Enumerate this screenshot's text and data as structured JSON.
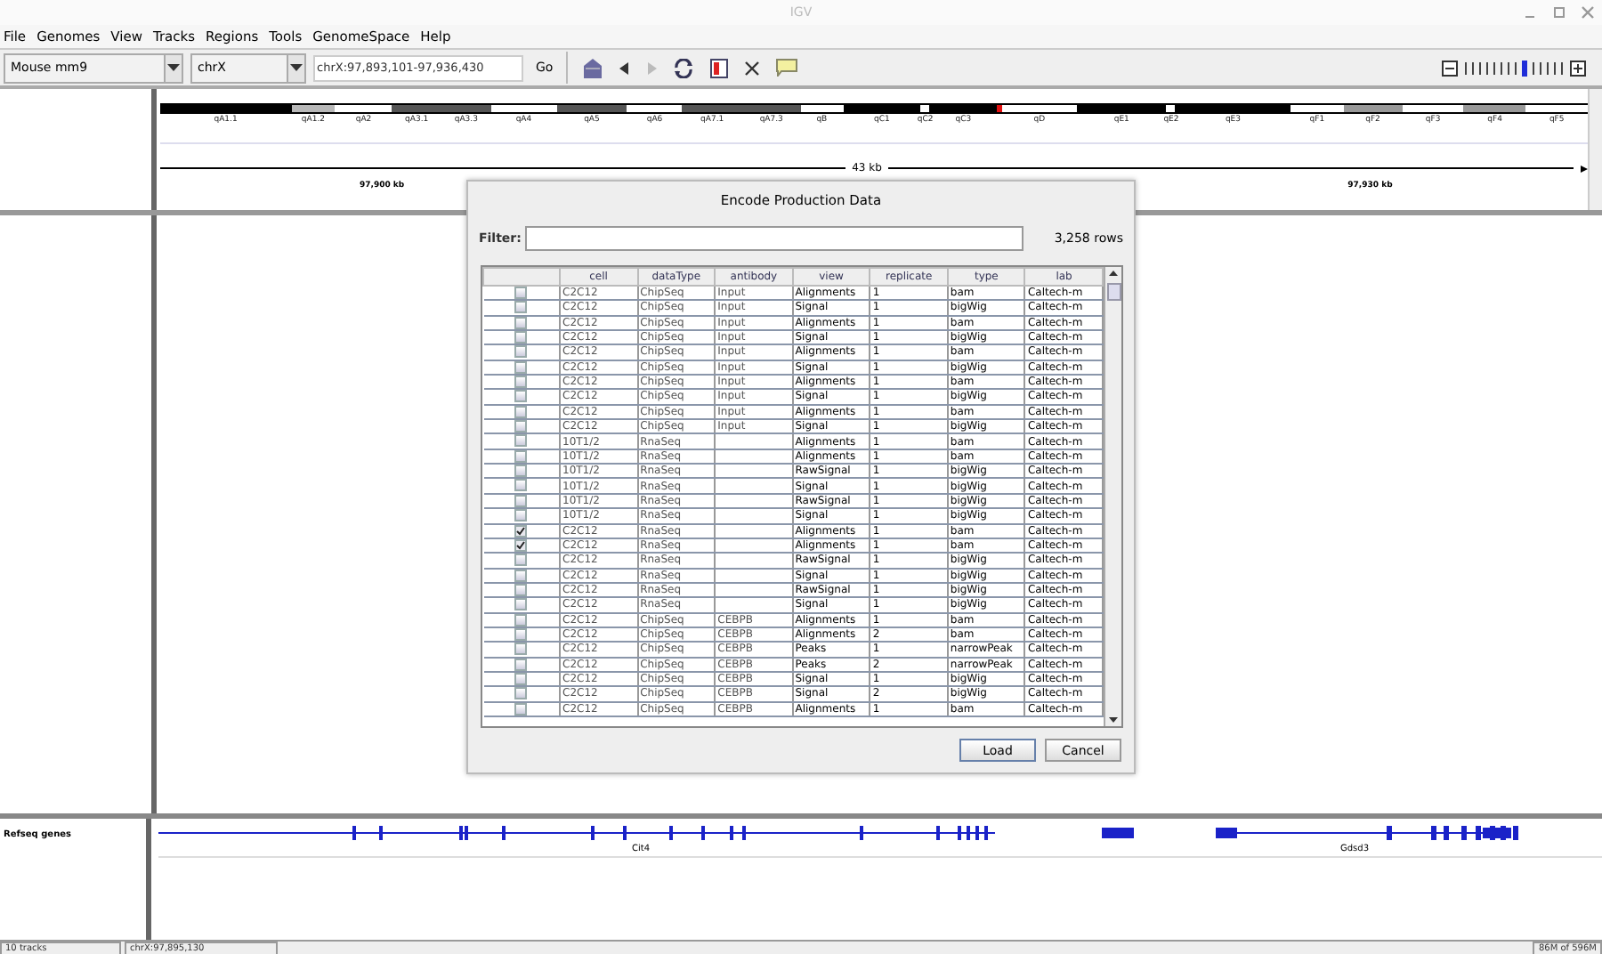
{
  "window": {
    "title": "IGV"
  },
  "menu": [
    "File",
    "Genomes",
    "View",
    "Tracks",
    "Regions",
    "Tools",
    "GenomeSpace",
    "Help"
  ],
  "toolbar": {
    "genome": "Mouse mm9",
    "chromosome": "chrX",
    "locus": "chrX:97,893,101-97,936,430",
    "go": "Go",
    "zoom": {
      "level": 0.6
    }
  },
  "cytoband": [
    {
      "label": "qA1.1",
      "color": "#000000"
    },
    {
      "label": "qA1.2",
      "color": "#b8b8b8"
    },
    {
      "label": "qA2",
      "color": "#ffffff"
    },
    {
      "label": "qA3.1",
      "color": "#555555"
    },
    {
      "label": "qA3.3",
      "color": "#555555"
    },
    {
      "label": "qA4",
      "color": "#ffffff"
    },
    {
      "label": "qA5",
      "color": "#555555"
    },
    {
      "label": "qA6",
      "color": "#ffffff"
    },
    {
      "label": "qA7.1",
      "color": "#555555"
    },
    {
      "label": "qA7.3",
      "color": "#555555"
    },
    {
      "label": "qB",
      "color": "#ffffff"
    },
    {
      "label": "qC1",
      "color": "#000000"
    },
    {
      "label": "qC2",
      "color": "#ffffff"
    },
    {
      "label": "qC3",
      "color": "#000000"
    },
    {
      "color": "#e01010"
    },
    {
      "label": "qD",
      "color": "#ffffff"
    },
    {
      "label": "qE1",
      "color": "#000000"
    },
    {
      "label": "qE2",
      "color": "#ffffff"
    },
    {
      "label": "qE3",
      "color": "#000000"
    },
    {
      "label": "qF1",
      "color": "#ffffff"
    },
    {
      "label": "qF2",
      "color": "#999999"
    },
    {
      "label": "qF3",
      "color": "#ffffff"
    },
    {
      "label": "qF4",
      "color": "#999999"
    },
    {
      "label": "qF5",
      "color": "#ffffff"
    }
  ],
  "ruler": {
    "span": "43 kb",
    "ticks": [
      "97,900 kb",
      "97,930 kb"
    ]
  },
  "feature_track": {
    "name": "Refseq genes",
    "genes": [
      "Cit4",
      "Gdsd3"
    ]
  },
  "status_bar": [
    "10 tracks",
    "chrX:97,895,130",
    "86M of 596M"
  ],
  "dialog": {
    "title": "Encode Production Data",
    "filter_label": "Filter:",
    "count": "3,258 rows",
    "columns": [
      "cell",
      "dataType",
      "antibody",
      "view",
      "replicate",
      "type",
      "lab"
    ],
    "rows": [
      {
        "checked": false,
        "cells": [
          "C2C12",
          "ChipSeq",
          "Input",
          "Alignments",
          "1",
          "bam",
          "Caltech-m"
        ]
      },
      {
        "checked": false,
        "cells": [
          "C2C12",
          "ChipSeq",
          "Input",
          "Signal",
          "1",
          "bigWig",
          "Caltech-m"
        ]
      },
      {
        "checked": false,
        "cells": [
          "C2C12",
          "ChipSeq",
          "Input",
          "Alignments",
          "1",
          "bam",
          "Caltech-m"
        ]
      },
      {
        "checked": false,
        "cells": [
          "C2C12",
          "ChipSeq",
          "Input",
          "Signal",
          "1",
          "bigWig",
          "Caltech-m"
        ]
      },
      {
        "checked": false,
        "cells": [
          "C2C12",
          "ChipSeq",
          "Input",
          "Alignments",
          "1",
          "bam",
          "Caltech-m"
        ]
      },
      {
        "checked": false,
        "cells": [
          "C2C12",
          "ChipSeq",
          "Input",
          "Signal",
          "1",
          "bigWig",
          "Caltech-m"
        ]
      },
      {
        "checked": false,
        "cells": [
          "C2C12",
          "ChipSeq",
          "Input",
          "Alignments",
          "1",
          "bam",
          "Caltech-m"
        ]
      },
      {
        "checked": false,
        "cells": [
          "C2C12",
          "ChipSeq",
          "Input",
          "Signal",
          "1",
          "bigWig",
          "Caltech-m"
        ]
      },
      {
        "checked": false,
        "cells": [
          "C2C12",
          "ChipSeq",
          "Input",
          "Alignments",
          "1",
          "bam",
          "Caltech-m"
        ]
      },
      {
        "checked": false,
        "cells": [
          "C2C12",
          "ChipSeq",
          "Input",
          "Signal",
          "1",
          "bigWig",
          "Caltech-m"
        ]
      },
      {
        "checked": false,
        "cells": [
          "10T1/2",
          "RnaSeq",
          "",
          "Alignments",
          "1",
          "bam",
          "Caltech-m"
        ]
      },
      {
        "checked": false,
        "cells": [
          "10T1/2",
          "RnaSeq",
          "",
          "Alignments",
          "1",
          "bam",
          "Caltech-m"
        ]
      },
      {
        "checked": false,
        "cells": [
          "10T1/2",
          "RnaSeq",
          "",
          "RawSignal",
          "1",
          "bigWig",
          "Caltech-m"
        ]
      },
      {
        "checked": false,
        "cells": [
          "10T1/2",
          "RnaSeq",
          "",
          "Signal",
          "1",
          "bigWig",
          "Caltech-m"
        ]
      },
      {
        "checked": false,
        "cells": [
          "10T1/2",
          "RnaSeq",
          "",
          "RawSignal",
          "1",
          "bigWig",
          "Caltech-m"
        ]
      },
      {
        "checked": false,
        "cells": [
          "10T1/2",
          "RnaSeq",
          "",
          "Signal",
          "1",
          "bigWig",
          "Caltech-m"
        ]
      },
      {
        "checked": true,
        "cells": [
          "C2C12",
          "RnaSeq",
          "",
          "Alignments",
          "1",
          "bam",
          "Caltech-m"
        ]
      },
      {
        "checked": true,
        "cells": [
          "C2C12",
          "RnaSeq",
          "",
          "Alignments",
          "1",
          "bam",
          "Caltech-m"
        ]
      },
      {
        "checked": false,
        "cells": [
          "C2C12",
          "RnaSeq",
          "",
          "RawSignal",
          "1",
          "bigWig",
          "Caltech-m"
        ]
      },
      {
        "checked": false,
        "cells": [
          "C2C12",
          "RnaSeq",
          "",
          "Signal",
          "1",
          "bigWig",
          "Caltech-m"
        ]
      },
      {
        "checked": false,
        "cells": [
          "C2C12",
          "RnaSeq",
          "",
          "RawSignal",
          "1",
          "bigWig",
          "Caltech-m"
        ]
      },
      {
        "checked": false,
        "cells": [
          "C2C12",
          "RnaSeq",
          "",
          "Signal",
          "1",
          "bigWig",
          "Caltech-m"
        ]
      },
      {
        "checked": false,
        "cells": [
          "C2C12",
          "ChipSeq",
          "CEBPB",
          "Alignments",
          "1",
          "bam",
          "Caltech-m"
        ]
      },
      {
        "checked": false,
        "cells": [
          "C2C12",
          "ChipSeq",
          "CEBPB",
          "Alignments",
          "2",
          "bam",
          "Caltech-m"
        ]
      },
      {
        "checked": false,
        "cells": [
          "C2C12",
          "ChipSeq",
          "CEBPB",
          "Peaks",
          "1",
          "narrowPeak",
          "Caltech-m"
        ]
      },
      {
        "checked": false,
        "cells": [
          "C2C12",
          "ChipSeq",
          "CEBPB",
          "Peaks",
          "2",
          "narrowPeak",
          "Caltech-m"
        ]
      },
      {
        "checked": false,
        "cells": [
          "C2C12",
          "ChipSeq",
          "CEBPB",
          "Signal",
          "1",
          "bigWig",
          "Caltech-m"
        ]
      },
      {
        "checked": false,
        "cells": [
          "C2C12",
          "ChipSeq",
          "CEBPB",
          "Signal",
          "2",
          "bigWig",
          "Caltech-m"
        ]
      },
      {
        "checked": false,
        "cells": [
          "C2C12",
          "ChipSeq",
          "CEBPB",
          "Alignments",
          "1",
          "bam",
          "Caltech-m"
        ]
      }
    ],
    "buttons": [
      {
        "label": "Load",
        "focused": true
      },
      {
        "label": "Cancel",
        "focused": false
      }
    ]
  }
}
